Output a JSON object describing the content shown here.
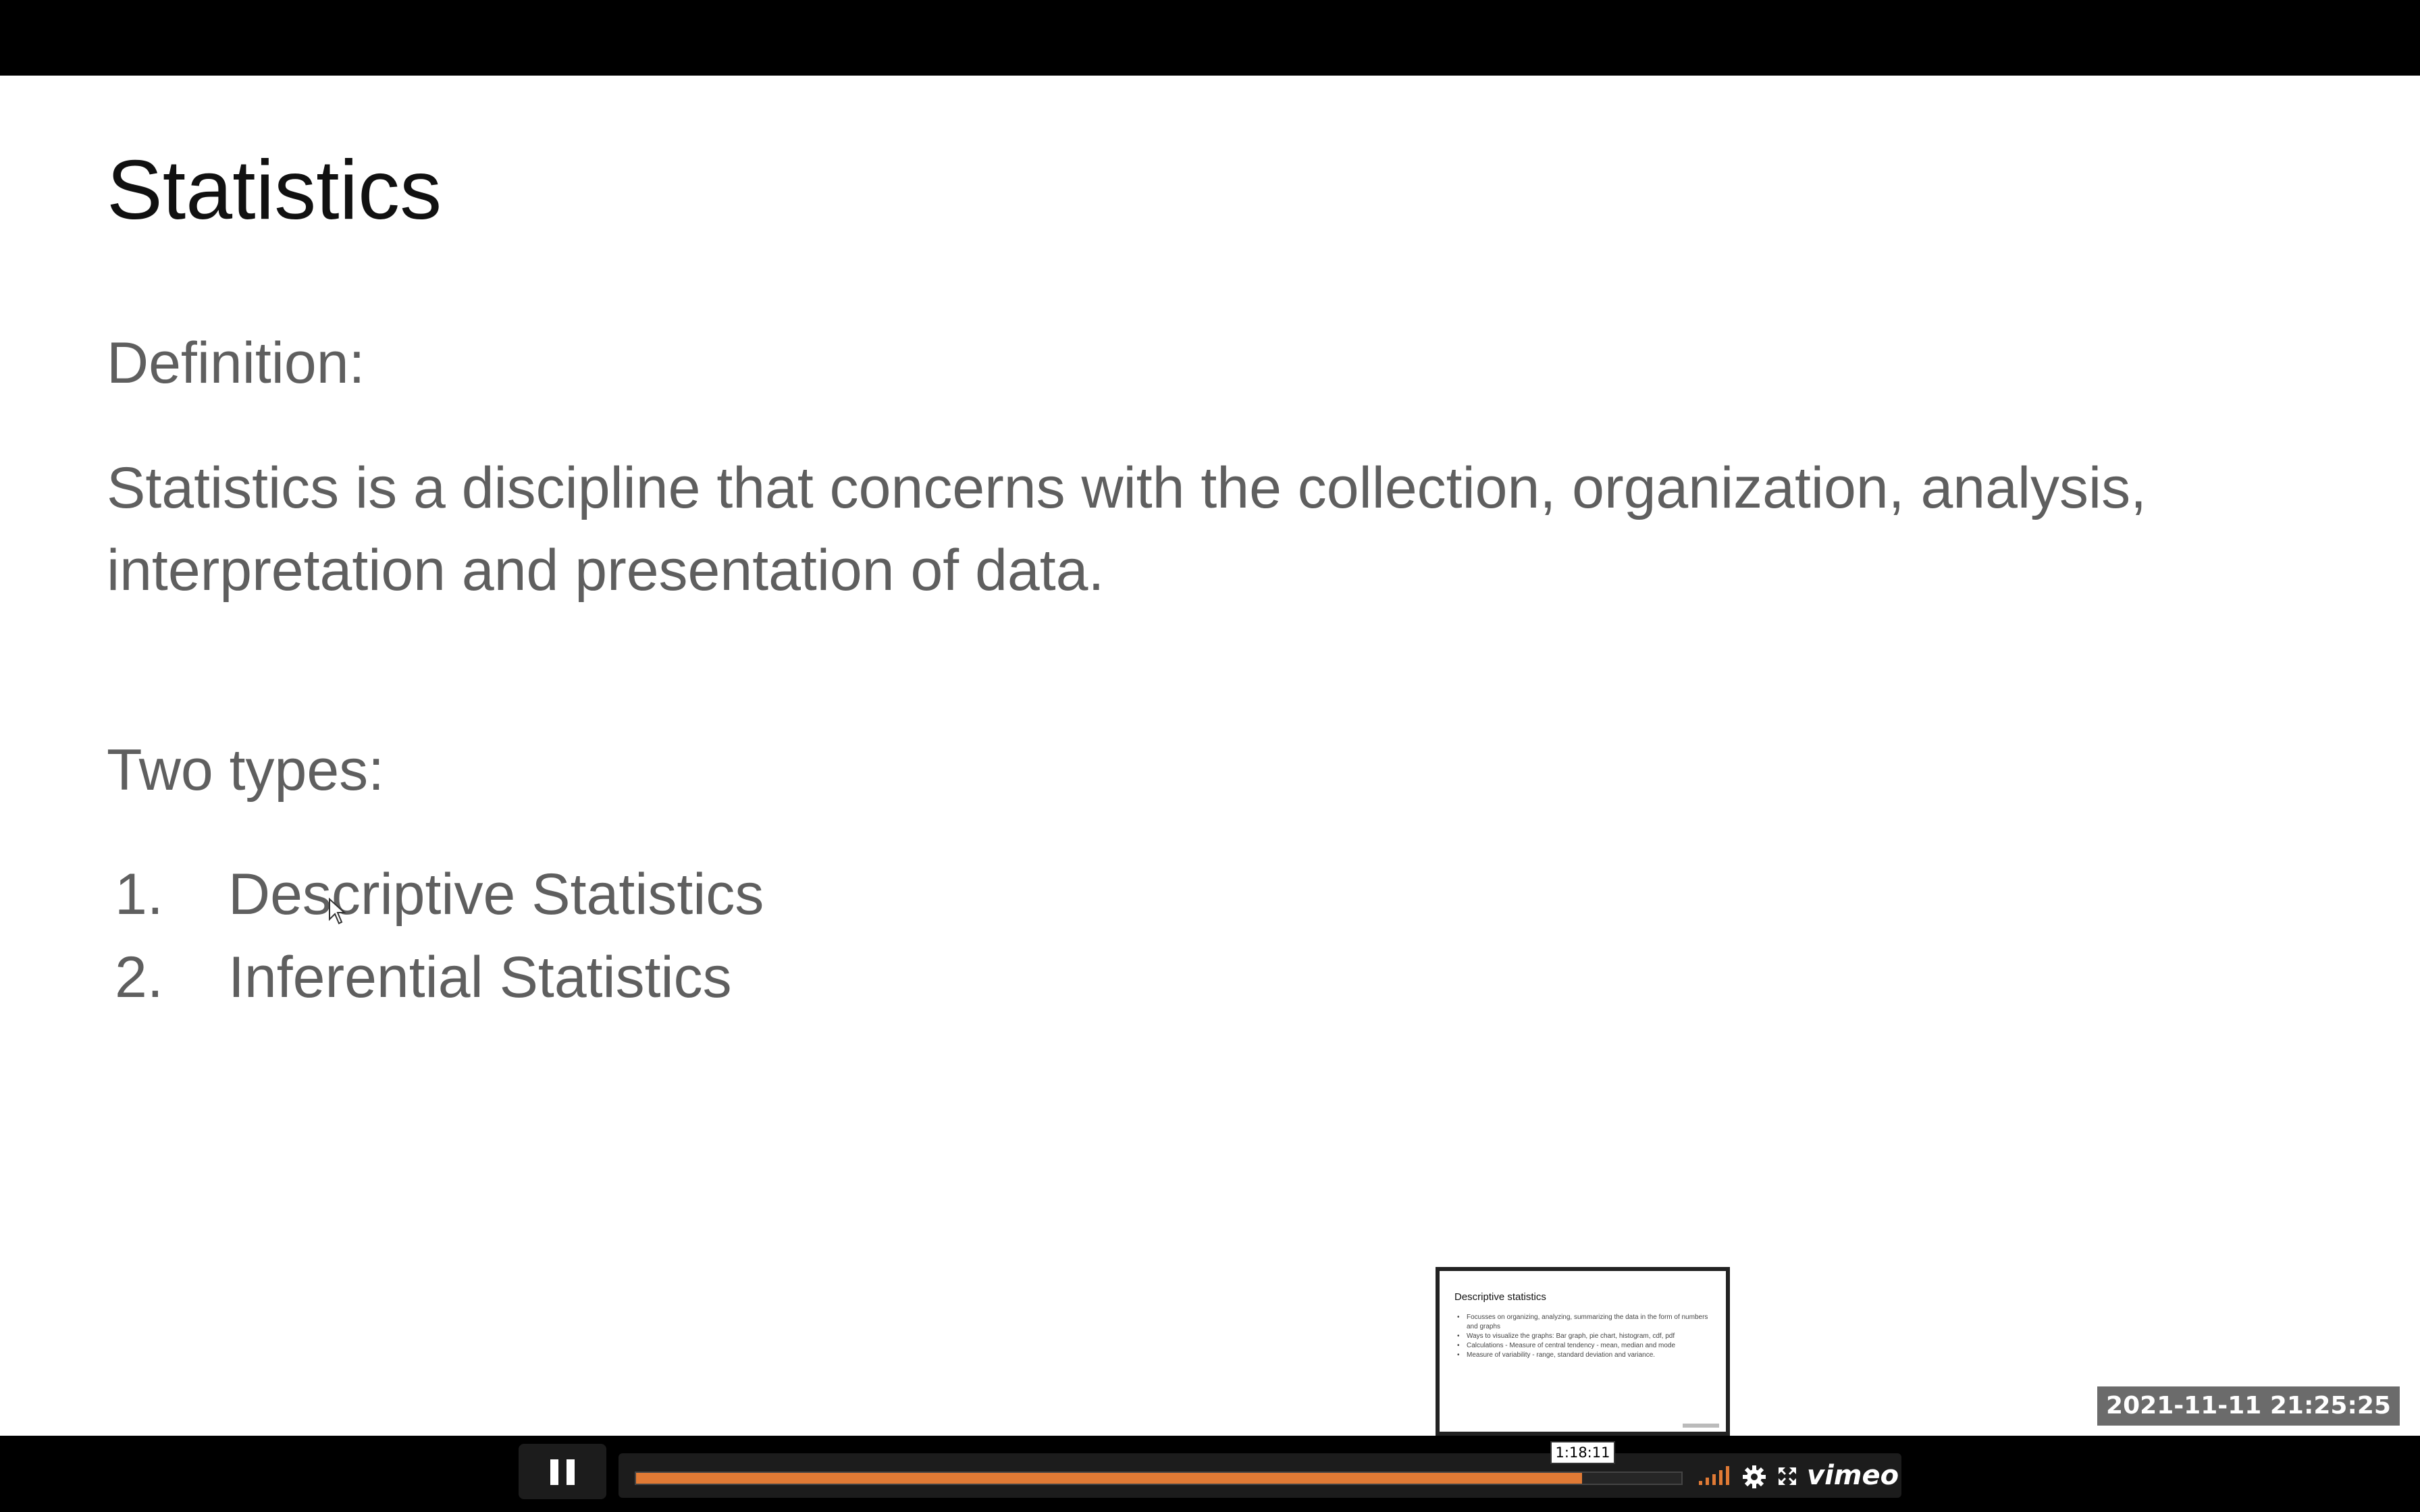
{
  "slide": {
    "title": "Statistics",
    "definition_label": "Definition:",
    "definition_line1": "Statistics is a discipline that concerns with the collection, organization, analysis,",
    "definition_line2": "interpretation and presentation of data.",
    "types_label": "Two types:",
    "types": [
      {
        "number": "1.",
        "label": "Descriptive Statistics"
      },
      {
        "number": "2.",
        "label": "Inferential Statistics"
      }
    ]
  },
  "preview": {
    "title": "Descriptive statistics",
    "bullets": [
      "Focusses on organizing, analyzing, summarizing the data in the form of numbers and graphs",
      "Ways to visualize the graphs: Bar graph, pie chart, histogram, cdf, pdf",
      "Calculations - Measure of central tendency - mean, median and mode",
      "Measure of variability - range, standard deviation and variance."
    ]
  },
  "overlay": {
    "timestamp": "2021-11-11  21:25:25"
  },
  "player": {
    "hover_time": "1:18:11",
    "progress_fraction": 0.905,
    "accent_color": "#e07a35",
    "logo_text": "vimeo",
    "icons": [
      "pause-icon",
      "volume-icon",
      "settings-gear-icon",
      "fullscreen-icon"
    ]
  }
}
